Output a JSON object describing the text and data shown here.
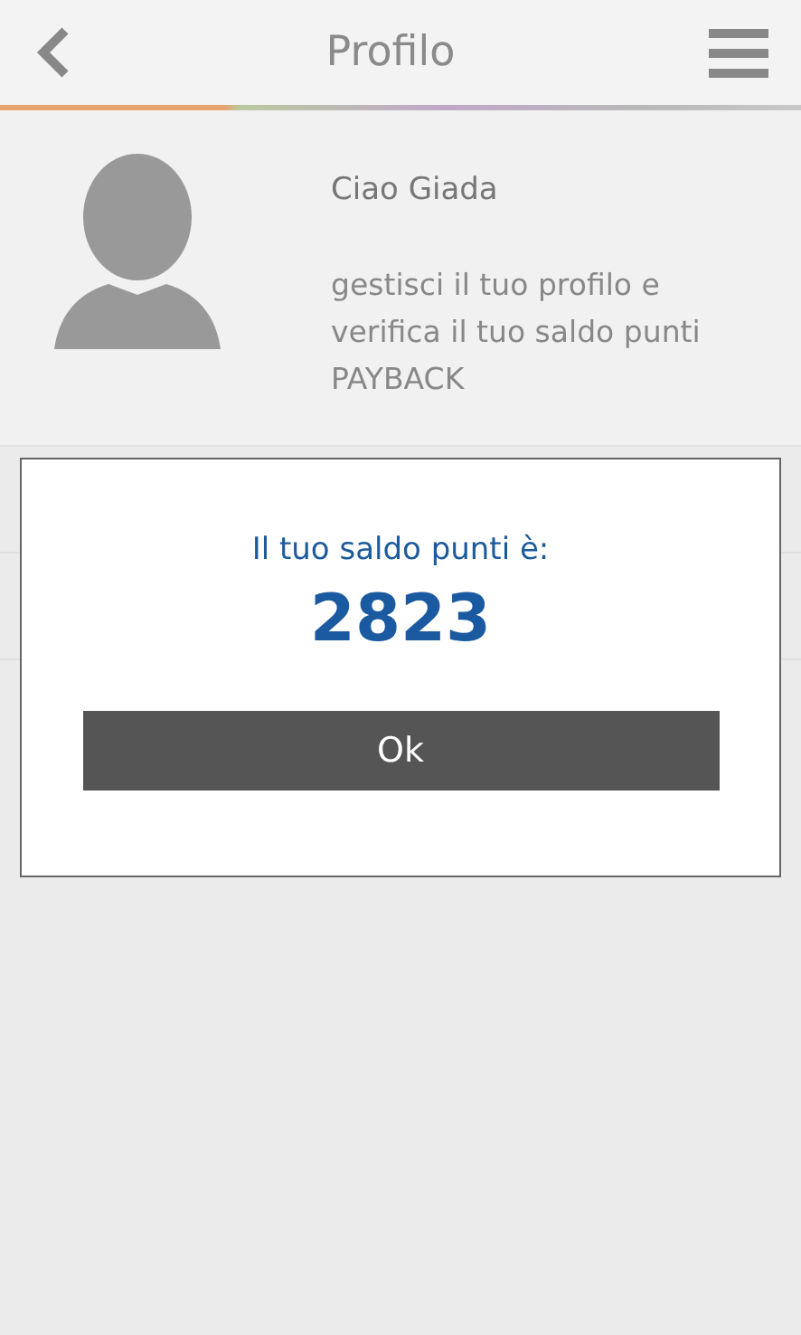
{
  "header": {
    "title": "Profilo"
  },
  "profile": {
    "greeting": "Ciao Giada",
    "description": "gestisci il tuo profilo e verifica il tuo saldo punti PAYBACK"
  },
  "dialog": {
    "message": "Il tuo saldo punti è:",
    "points": "2823",
    "button": "Ok"
  }
}
